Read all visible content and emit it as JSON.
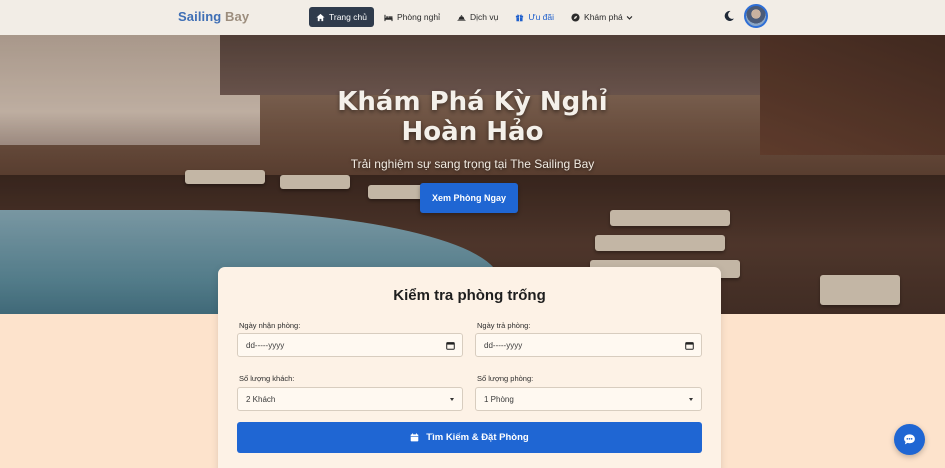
{
  "brand": {
    "part1": "Sailing",
    "part2": "Bay"
  },
  "nav": {
    "items": [
      {
        "label": "Trang chủ",
        "icon": "home-icon",
        "active": true
      },
      {
        "label": "Phòng nghỉ",
        "icon": "bed-icon"
      },
      {
        "label": "Dịch vụ",
        "icon": "bell-icon"
      },
      {
        "label": "Ưu đãi",
        "icon": "gift-icon",
        "highlight": true
      },
      {
        "label": "Khám phá",
        "icon": "compass-icon",
        "dropdown": true
      }
    ],
    "theme_icon": "moon-icon",
    "avatar_icon": "avatar"
  },
  "hero": {
    "title_line1": "Khám Phá Kỳ Nghỉ",
    "title_line2": "Hoàn Hảo",
    "subtitle": "Trải nghiệm sự sang trọng tại The Sailing Bay",
    "cta_label": "Xem Phòng Ngay"
  },
  "booking": {
    "title": "Kiểm tra phòng trống",
    "checkin": {
      "label": "Ngày nhận phòng:",
      "value": "dd-----yyyy"
    },
    "checkout": {
      "label": "Ngày trả phòng:",
      "value": "dd-----yyyy"
    },
    "guests": {
      "label": "Số lượng khách:",
      "value": "2 Khách"
    },
    "rooms": {
      "label": "Số lượng phòng:",
      "value": "1 Phòng"
    },
    "submit_label": "Tìm Kiếm & Đặt Phòng"
  },
  "colors": {
    "primary": "#1f66d3",
    "nav_active": "#2f3b4c",
    "page_bg": "#fde3cc",
    "card_bg": "#fdf2e6"
  }
}
